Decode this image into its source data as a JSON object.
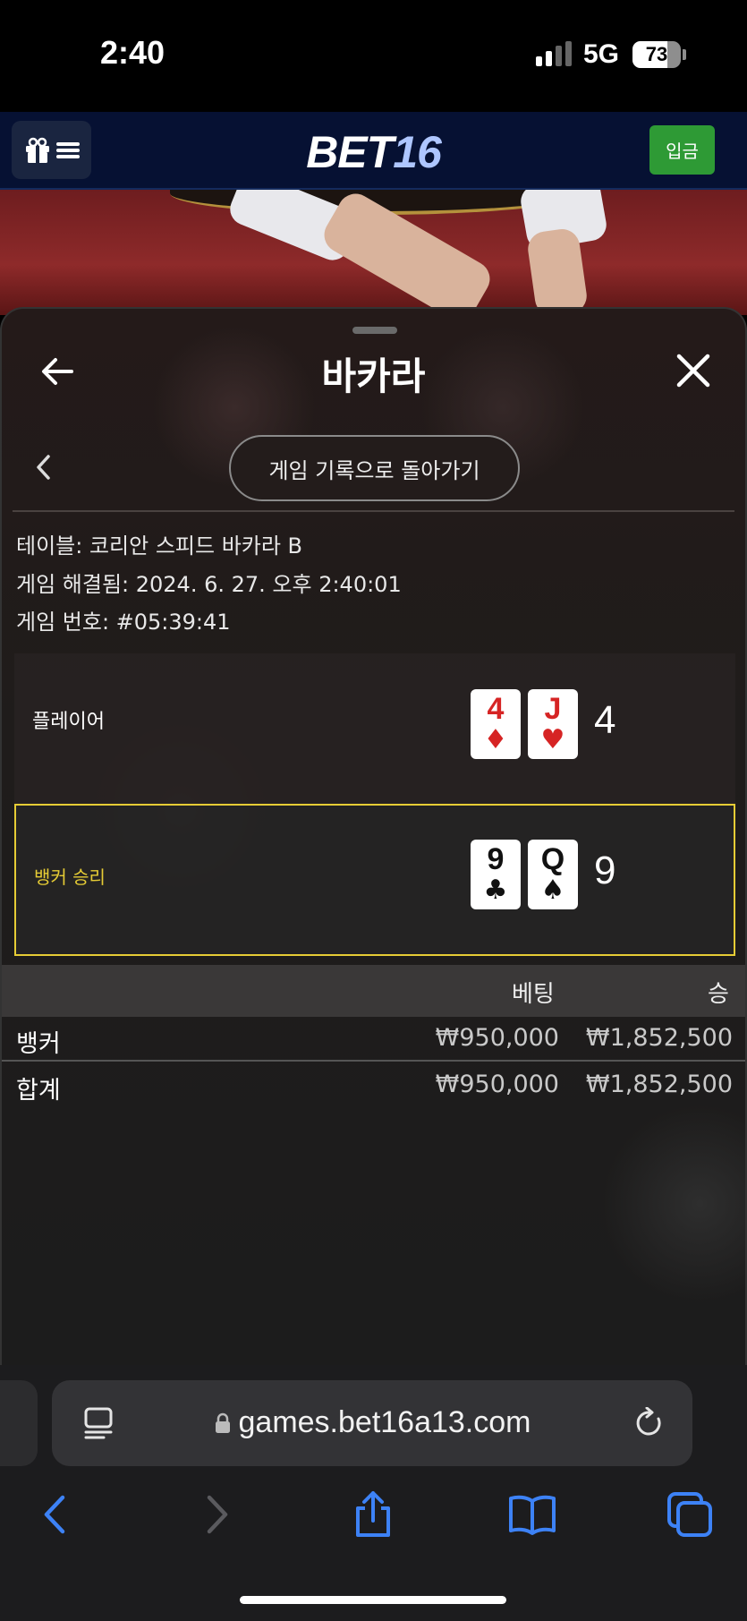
{
  "status_bar": {
    "time": "2:40",
    "network": "5G",
    "battery": "73",
    "battery_level": 0.73
  },
  "header": {
    "logo_main": "BET",
    "logo_num": "16",
    "deposit_label": "입금"
  },
  "sheet": {
    "title": "바카라",
    "history_button": "게임 기록으로 돌아가기",
    "table_info": "테이블: 코리안 스피드 바카라 B",
    "resolved_info": "게임 해결됨: 2024. 6. 27. 오후 2:40:01",
    "game_number": "게임 번호: #05:39:41",
    "player": {
      "label": "플레이어",
      "cards": [
        {
          "rank": "4",
          "suit": "♦",
          "color": "red"
        },
        {
          "rank": "J",
          "suit": "♥",
          "color": "red"
        }
      ],
      "score": "4"
    },
    "banker": {
      "label": "뱅커 승리",
      "cards": [
        {
          "rank": "9",
          "suit": "♣",
          "color": "black"
        },
        {
          "rank": "Q",
          "suit": "♠",
          "color": "black"
        }
      ],
      "score": "9"
    },
    "bets_table": {
      "headers": {
        "bet": "베팅",
        "win": "승"
      },
      "rows": [
        {
          "name": "뱅커",
          "bet": "₩950,000",
          "win": "₩1,852,500"
        }
      ],
      "total": {
        "name": "합계",
        "bet": "₩950,000",
        "win": "₩1,852,500"
      }
    }
  },
  "browser": {
    "url": "games.bet16a13.com"
  },
  "colors": {
    "header_bg": "#061133",
    "deposit": "#2e9a35",
    "banker_highlight": "#e6cc35",
    "link_blue": "#3d82f6"
  }
}
